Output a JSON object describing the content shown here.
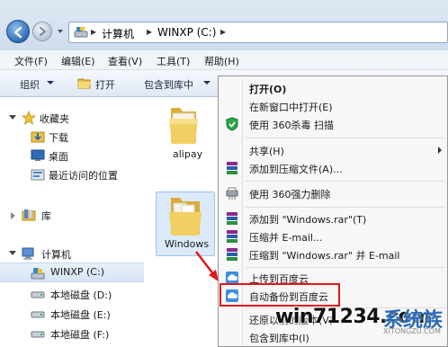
{
  "address_bar": {
    "path": [
      "计算机",
      "WINXP (C:)"
    ]
  },
  "menu_bar": {
    "items": [
      "文件(F)",
      "编辑(E)",
      "查看(V)",
      "工具(T)",
      "帮助(H)"
    ]
  },
  "command_bar": {
    "organize": "组织",
    "open": "打开",
    "include_in_library": "包含到库中"
  },
  "nav_pane": {
    "favorites": "收藏夹",
    "downloads": "下载",
    "desktop": "桌面",
    "recent": "最近访问的位置",
    "libraries": "库",
    "computer": "计算机",
    "drives": [
      {
        "label": "WINXP (C:)",
        "selected": true
      },
      {
        "label": "本地磁盘 (D:)",
        "selected": false
      },
      {
        "label": "本地磁盘 (E:)",
        "selected": false
      },
      {
        "label": "本地磁盘 (F:)",
        "selected": false
      }
    ]
  },
  "content": {
    "folders": [
      "alipay",
      "Windows"
    ]
  },
  "context_menu": {
    "items": [
      {
        "label": "打开(O)",
        "bold": true,
        "icon": ""
      },
      {
        "label": "在新窗口中打开(E)",
        "icon": ""
      },
      {
        "label": "使用 360杀毒 扫描",
        "icon": "360-shield-icon"
      },
      {
        "label": "共享(H)",
        "icon": "",
        "submenu": true
      },
      {
        "label": "添加到压缩文件(A)...",
        "icon": "winrar-icon"
      },
      {
        "label": "使用 360强力删除",
        "icon": "shredder-icon"
      },
      {
        "label": "添加到 \"Windows.rar\"(T)",
        "icon": "winrar-icon"
      },
      {
        "label": "压缩并 E-mail...",
        "icon": "winrar-icon"
      },
      {
        "label": "压缩到 \"Windows.rar\" 并 E-mail",
        "icon": "winrar-icon"
      },
      {
        "label": "上传到百度云",
        "icon": "baidu-cloud-icon"
      },
      {
        "label": "自动备份到百度云",
        "icon": "baidu-cloud-icon",
        "highlighted": true
      },
      {
        "label": "还原以前的版本(V)",
        "icon": ""
      },
      {
        "label": "包含到库中(I)",
        "icon": ""
      }
    ]
  },
  "watermark": {
    "text": "win71234.com",
    "brand": "系统族",
    "url": "XITONGZU.COM"
  },
  "colors": {
    "annotation_red": "#e0161c",
    "selection_blue": "#dbe9f9"
  }
}
